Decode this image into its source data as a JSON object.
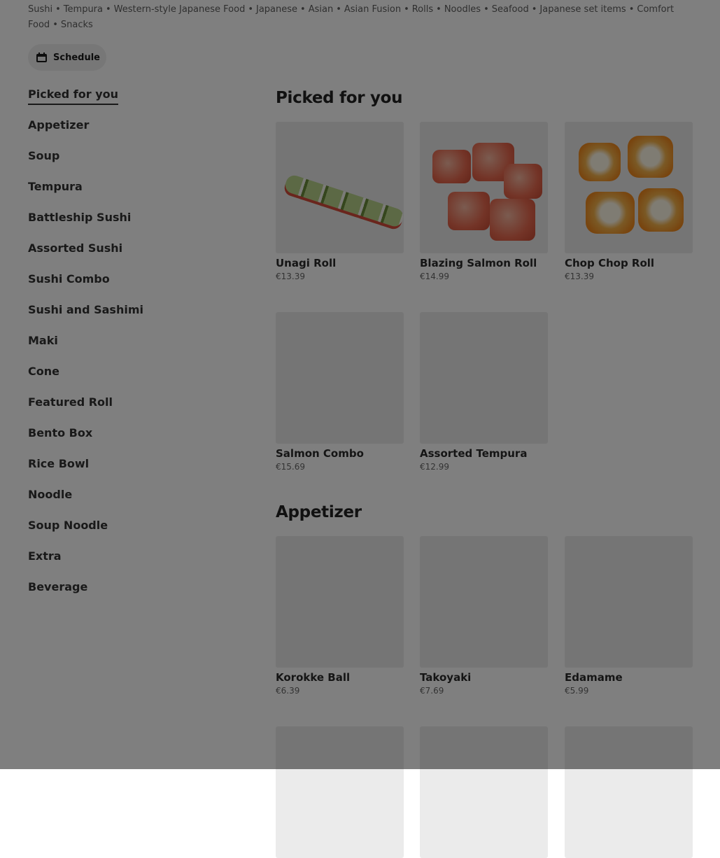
{
  "cuisines": [
    "Sushi",
    "Tempura",
    "Western-style Japanese Food",
    "Japanese",
    "Asian",
    "Asian Fusion",
    "Rolls",
    "Noodles",
    "Seafood",
    "Japanese set items",
    "Comfort Food",
    "Snacks"
  ],
  "schedule_label": "Schedule",
  "sidebar": {
    "items": [
      {
        "label": "Picked for you"
      },
      {
        "label": "Appetizer"
      },
      {
        "label": "Soup"
      },
      {
        "label": "Tempura"
      },
      {
        "label": "Battleship Sushi"
      },
      {
        "label": "Assorted Sushi"
      },
      {
        "label": "Sushi Combo"
      },
      {
        "label": "Sushi and Sashimi"
      },
      {
        "label": "Maki"
      },
      {
        "label": "Cone"
      },
      {
        "label": "Featured Roll"
      },
      {
        "label": "Bento Box"
      },
      {
        "label": "Rice Bowl"
      },
      {
        "label": "Noodle"
      },
      {
        "label": "Soup Noodle"
      },
      {
        "label": "Extra"
      },
      {
        "label": "Beverage"
      }
    ],
    "active_index": 0
  },
  "sections": [
    {
      "title": "Picked for you",
      "items": [
        {
          "name": "Unagi Roll",
          "price": "€13.39",
          "image": "unagi"
        },
        {
          "name": "Blazing Salmon Roll",
          "price": "€14.99",
          "image": "blazing"
        },
        {
          "name": "Chop Chop Roll",
          "price": "€13.39",
          "image": "chop"
        },
        {
          "name": "Salmon Combo",
          "price": "€15.69",
          "image": "placeholder"
        },
        {
          "name": "Assorted Tempura",
          "price": "€12.99",
          "image": "placeholder"
        }
      ]
    },
    {
      "title": "Appetizer",
      "items": [
        {
          "name": "Korokke Ball",
          "price": "€6.39",
          "image": "placeholder"
        },
        {
          "name": "Takoyaki",
          "price": "€7.69",
          "image": "placeholder"
        },
        {
          "name": "Edamame",
          "price": "€5.99",
          "image": "placeholder"
        }
      ]
    }
  ],
  "overlay_color": "#000000"
}
